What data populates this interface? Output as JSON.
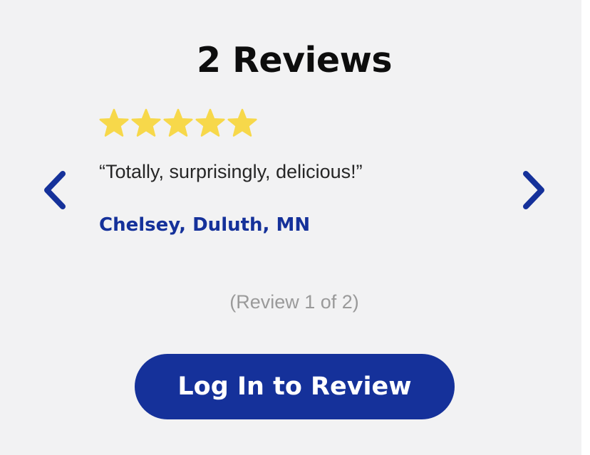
{
  "reviews": {
    "title": "2 Reviews",
    "rating": 5,
    "max_rating": 5,
    "current": {
      "quote": "“Totally, surprisingly, delicious!”",
      "author": "Chelsey, Duluth, MN"
    },
    "counter": "(Review 1 of 2)",
    "login_button": "Log In to Review"
  },
  "icons": {
    "star": "star-icon",
    "prev": "chevron-left-icon",
    "next": "chevron-right-icon"
  },
  "colors": {
    "background": "#f2f2f3",
    "title": "#0d0d0d",
    "brand_blue": "#15319a",
    "star_fill": "#f7d84a",
    "quote_text": "#262626",
    "counter_text": "#9a9a9a",
    "button_text": "#ffffff"
  }
}
